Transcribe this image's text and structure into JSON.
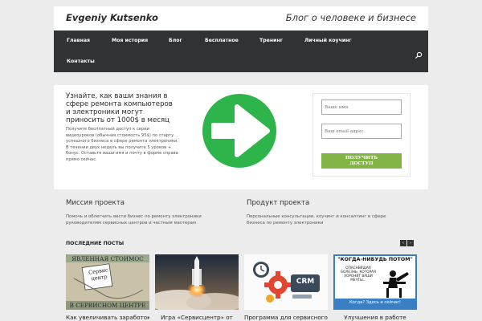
{
  "header": {
    "site_title": "Evgeniy Kutsenko",
    "tagline": "Блог о человеке и бизнесе"
  },
  "nav": {
    "items": [
      {
        "label": "Главная"
      },
      {
        "label": "Моя история"
      },
      {
        "label": "Блог"
      },
      {
        "label": "Бесплатное"
      },
      {
        "label": "Тренинг"
      },
      {
        "label": "Личный коучинг"
      },
      {
        "label": "Контакты"
      }
    ],
    "search_icon": "search-icon"
  },
  "promo": {
    "title": "Узнайте, как ваши знания в сфере ремонта компьютеров и электроники могут приносить от 1000$ в месяц",
    "text": "Получите бесплатный доступ к серии видеоуроков (обычная стоимость 95$) по старту успешного бизнеса в сфере ремонта электроники. В течении двух недель вы получите 5 уроков + бонус. Оставьте ваши имя и почту в форме справа прямо сейчас.",
    "image_icon": "arrow-right-icon",
    "image_color": "#2db44a",
    "form": {
      "name_placeholder": "Ваше имя",
      "email_placeholder": "Ваш email-адрес",
      "submit_label": "ПОЛУЧИТЬ ДОСТУП",
      "button_color": "#83b446"
    }
  },
  "mission": {
    "title": "Миссия проекта",
    "text": "Помочь и облегчить вести бизнес по ремонту электроники руководителям сервисных центров и частным мастерам"
  },
  "product": {
    "title": "Продукт проекта",
    "text": "Персональные консультации, коучинг и консалтинг в сфере бизнеса по ремонту электроники"
  },
  "posts": {
    "title": "ПОСЛЕДНИЕ ПОСТЫ",
    "prev_icon": "chevron-left-icon",
    "next_icon": "chevron-right-icon",
    "items": [
      {
        "title": "Как увеличивать заработок",
        "thumb_top": "ЯВЛЕННАЯ СТОИМОС",
        "thumb_note": "Сервис центр",
        "thumb_bottom": "В СЕРВИСНОМ ЦЕНТРЕ"
      },
      {
        "title": "Игра «Сервисцентр» от"
      },
      {
        "title": "Программа для сервисного",
        "thumb_text": "CRM"
      },
      {
        "title": "Улучшения в работе",
        "thumb_top": "\"КОГДА-НИБУДЬ ПОТОМ\"",
        "thumb_lines": "ОПАСНЕЙШАЯ БОЛЕЗНЬ, КОТОРАЯ ХОРОНИТ ВАШИ МЕЧТЫ...",
        "thumb_bottom": "Когда? Здесь и сейчас!"
      }
    ]
  }
}
